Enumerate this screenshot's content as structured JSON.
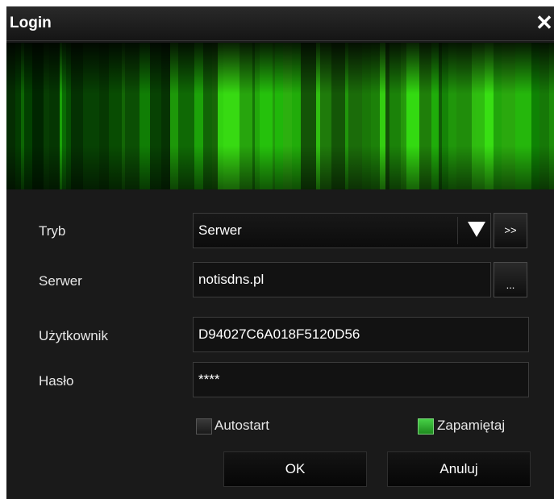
{
  "window": {
    "title": "Login",
    "close_symbol": "✕"
  },
  "banner": {
    "description_icon": "green-equalizer-banner"
  },
  "form": {
    "mode": {
      "label": "Tryb",
      "value": "Serwer",
      "more_button": ">>"
    },
    "server": {
      "label": "Serwer",
      "value": "notisdns.pl",
      "browse_button": "..."
    },
    "user": {
      "label": "Użytkownik",
      "value": "D94027C6A018F5120D56"
    },
    "password": {
      "label": "Hasło",
      "value": "****"
    },
    "autostart": {
      "label": "Autostart",
      "checked": false
    },
    "remember": {
      "label": "Zapamiętaj",
      "checked": true
    }
  },
  "buttons": {
    "ok": "OK",
    "cancel": "Anuluj"
  },
  "colors": {
    "background": "#1a1a1a",
    "accent": "#2fbf2f"
  }
}
